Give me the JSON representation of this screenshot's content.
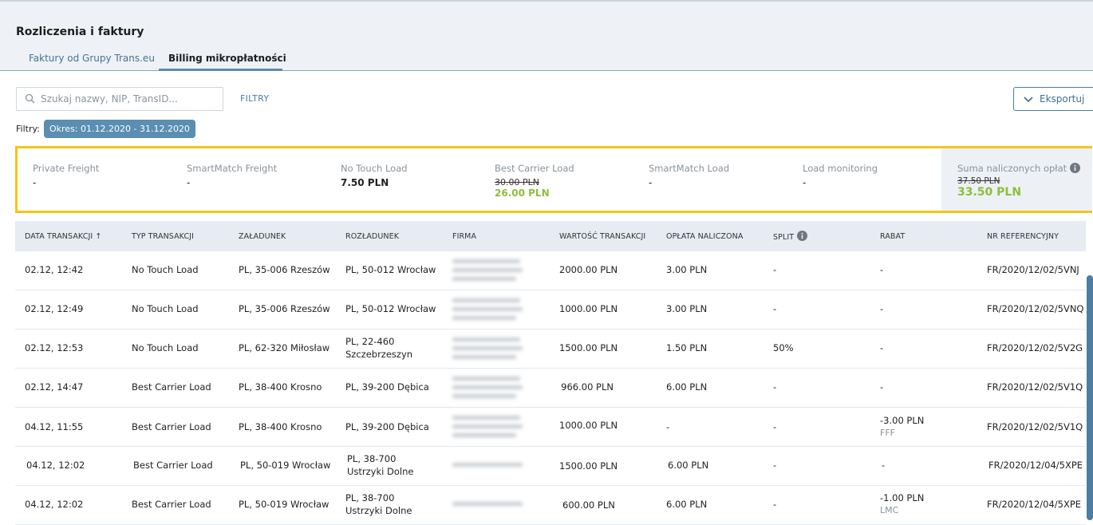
{
  "header": {
    "title": "Rozliczenia i faktury",
    "tabs": [
      {
        "label": "Faktury od Grupy Trans.eu",
        "active": false
      },
      {
        "label": "Billing mikropłatności",
        "active": true
      }
    ]
  },
  "toolbar": {
    "search_placeholder": "Szukaj nazwy, NIP, TransID...",
    "filters_button": "FILTRY",
    "export_button": "Eksportuj"
  },
  "filters": {
    "label": "Filtry:",
    "chips": [
      "Okres: 01.12.2020 - 31.12.2020"
    ]
  },
  "summary": {
    "items": [
      {
        "label": "Private Freight",
        "value": "-"
      },
      {
        "label": "SmartMatch Freight",
        "value": "-"
      },
      {
        "label": "No Touch Load",
        "value": "7.50 PLN"
      },
      {
        "label": "Best Carrier Load",
        "old_value": "30.00 PLN",
        "new_value": "26.00 PLN"
      },
      {
        "label": "SmartMatch Load",
        "value": "-"
      },
      {
        "label": "Load monitoring",
        "value": "-"
      }
    ],
    "total": {
      "label": "Suma naliczonych opłat",
      "old_value": "37.50 PLN",
      "new_value": "33.50 PLN"
    }
  },
  "table": {
    "columns": [
      "DATA TRANSAKCJI ↑",
      "TYP TRANSAKCJI",
      "ZAŁADUNEK",
      "ROZŁADUNEK",
      "FIRMA",
      "WARTOŚĆ TRANSAKCJI",
      "OPŁATA NALICZONA",
      "SPLIT",
      "RABAT",
      "NR REFERENCYJNY"
    ],
    "rows": [
      {
        "date": "02.12, 12:42",
        "type": "No Touch Load",
        "load": "PL, 35-006 Rzeszów",
        "unload": "PL, 50-012 Wrocław",
        "value": "2000.00 PLN",
        "fee": "3.00 PLN",
        "split": "-",
        "discount": "-",
        "discount_note": "",
        "ref": "FR/2020/12/02/5VNJ"
      },
      {
        "date": "02.12, 12:49",
        "type": "No Touch Load",
        "load": "PL, 35-006 Rzeszów",
        "unload": "PL, 50-012 Wrocław",
        "value": "1000.00 PLN",
        "fee": "3.00 PLN",
        "split": "-",
        "discount": "-",
        "discount_note": "",
        "ref": "FR/2020/12/02/5VNQ"
      },
      {
        "date": "02.12, 12:53",
        "type": "No Touch Load",
        "load": "PL, 62-320 Miłosław",
        "unload": "PL, 22-460 Szczebrzeszyn",
        "value": "1500.00 PLN",
        "fee": "1.50 PLN",
        "split": "50%",
        "discount": "-",
        "discount_note": "",
        "ref": "FR/2020/12/02/5V2G"
      },
      {
        "date": "02.12, 14:47",
        "type": "Best Carrier Load",
        "load": "PL, 38-400 Krosno",
        "unload": "PL, 39-200 Dębica",
        "value": "966.00 PLN",
        "fee": "6.00 PLN",
        "split": "-",
        "discount": "-",
        "discount_note": "",
        "ref": "FR/2020/12/02/5V1Q"
      },
      {
        "date": "04.12, 11:55",
        "type": "Best Carrier Load",
        "load": "PL, 38-400 Krosno",
        "unload": "PL, 39-200 Dębica",
        "value": "1000.00 PLN",
        "fee": "-",
        "split": "-",
        "discount": "-3.00 PLN",
        "discount_note": "FFF",
        "ref": "FR/2020/12/02/5V1Q"
      },
      {
        "date": "04.12, 12:02",
        "type": "Best Carrier Load",
        "load": "PL, 50-019 Wrocław",
        "unload": "PL, 38-700 Ustrzyki Dolne",
        "value": "1500.00 PLN",
        "fee": "6.00 PLN",
        "split": "-",
        "discount": "-",
        "discount_note": "",
        "ref": "FR/2020/12/04/5XPE"
      },
      {
        "date": "04.12, 12:02",
        "type": "Best Carrier Load",
        "load": "PL, 50-019 Wrocław",
        "unload": "PL, 38-700 Ustrzyki Dolne",
        "value": "600.00 PLN",
        "fee": "6.00 PLN",
        "split": "-",
        "discount": "-1.00 PLN",
        "discount_note": "LMC",
        "ref": "FR/2020/12/04/5XPE"
      }
    ]
  }
}
